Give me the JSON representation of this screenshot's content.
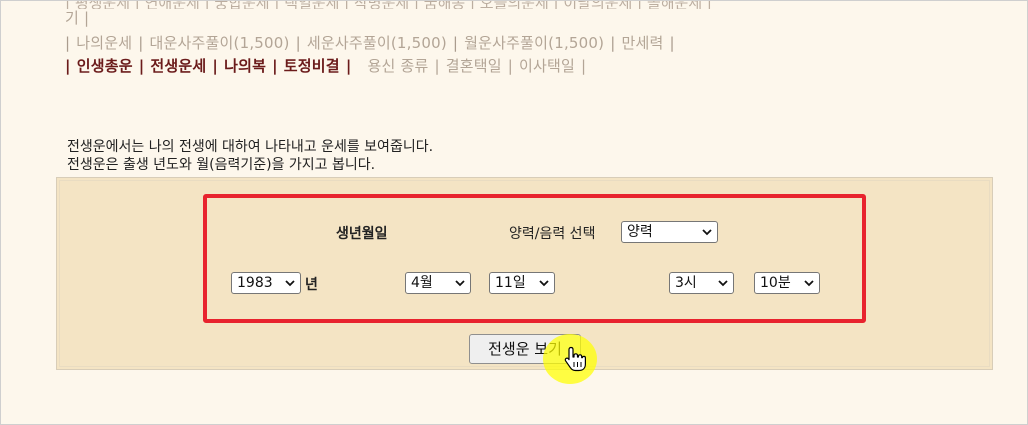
{
  "nav": {
    "row0": {
      "text": "기 |"
    },
    "row1": {
      "items": [
        "나의운세",
        "대운사주풀이(1,500)",
        "세운사주풀이(1,500)",
        "월운사주풀이(1,500)",
        "만세력"
      ]
    },
    "row2": {
      "bold_items": [
        "인생총운",
        "전생운세",
        "나의복",
        "토정비결"
      ],
      "light_items": [
        "용신 종류",
        "결혼택일",
        "이사택일"
      ]
    },
    "separator": "|"
  },
  "description": {
    "line1": "전생운에서는 나의 전생에 대하여 나타내고 운세를 보여줍니다.",
    "line2": "전생운은 출생 년도와 월(음력기준)을 가지고 봅니다."
  },
  "form": {
    "birth_label": "생년월일",
    "calendar_label": "양력/음력 선택",
    "calendar_value": "양력",
    "year_value": "1983",
    "year_unit": "년",
    "month_value": "4월",
    "day_value": "11일",
    "hour_value": "3시",
    "minute_value": "10분",
    "submit_label": "전생운 보기"
  },
  "colors": {
    "page_bg": "#fdf7ec",
    "panel_bg": "#f4e4c4",
    "highlight": "#e8232e",
    "nav_bold": "#6b1b1b",
    "nav_light": "#b3a596",
    "cursor_halo": "#ffff00"
  },
  "icons": {
    "dropdown": "chevron-down-icon",
    "cursor": "hand-pointer-icon"
  }
}
